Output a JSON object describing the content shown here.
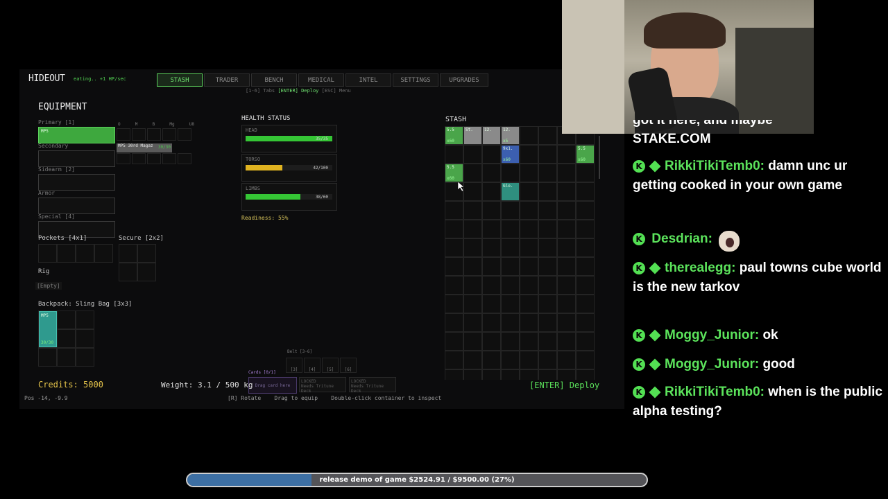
{
  "hud": {
    "title": "HIDEOUT",
    "regen": "eating.. +1 HP/sec",
    "tabs": [
      "STASH",
      "TRADER",
      "BENCH",
      "MEDICAL",
      "INTEL",
      "SETTINGS",
      "UPGRADES"
    ],
    "active_tab": "STASH",
    "hint_keys": "[1-6] Tabs",
    "hint_deploy": "[ENTER] Deploy",
    "hint_menu": "[ESC] Menu"
  },
  "equipment": {
    "heading": "EQUIPMENT",
    "primary_label": "Primary [1]",
    "primary_item": "MP5",
    "attach_labels": [
      "O",
      "M",
      "B",
      "Mg",
      "U8"
    ],
    "secondary_label": "Secondary",
    "mag_label": "MP5 30rd Magaz",
    "mag_count": "30/30",
    "sidearm_label": "Sidearm [2]",
    "armor_label": "Armor",
    "special_label": "Special [4]",
    "pockets_label": "Pockets [4x1]",
    "secure_label": "Secure [2x2]",
    "rig_label": "Rig",
    "rig_empty": "[Empty]",
    "backpack_label": "Backpack: Sling Bag [3x3]",
    "backpack_item": "MP5",
    "backpack_count": "30/30"
  },
  "health": {
    "heading": "HEALTH STATUS",
    "parts": [
      {
        "name": "HEAD",
        "value": "35/35",
        "fraction": 1.0,
        "color": "#35c635"
      },
      {
        "name": "TORSO",
        "value": "42/100",
        "fraction": 0.42,
        "color": "#e0b320"
      },
      {
        "name": "LIMBS",
        "value": "38/60",
        "fraction": 0.63,
        "color": "#35c635"
      }
    ],
    "readiness": "Readiness: 55%"
  },
  "stash": {
    "heading": "STASH",
    "items": [
      {
        "label": "5.5",
        "count": "x60",
        "color": "#4aa54a",
        "col": 0,
        "row": 0
      },
      {
        "label": "St.",
        "count": "",
        "color": "#8a8a8a",
        "col": 1,
        "row": 0
      },
      {
        "label": "12.",
        "count": "",
        "color": "#8a8a8a",
        "col": 2,
        "row": 0
      },
      {
        "label": "12.",
        "count": "x5",
        "color": "#8a8a8a",
        "col": 3,
        "row": 0
      },
      {
        "label": "9x1.",
        "count": "x60",
        "color": "#3c5fb0",
        "col": 3,
        "row": 1
      },
      {
        "label": "5.5",
        "count": "x60",
        "color": "#4aa54a",
        "col": 7,
        "row": 1
      },
      {
        "label": "5.5",
        "count": "x60",
        "color": "#4aa54a",
        "col": 0,
        "row": 2
      },
      {
        "label": "Glo.",
        "count": "",
        "color": "#2f8f7f",
        "col": 3,
        "row": 3
      }
    ]
  },
  "bottom": {
    "belt_label": "Belt [3-6]",
    "belt_slots": [
      "[3]",
      "[4]",
      "[5]",
      "[6]"
    ],
    "cards_label": "Cards [0/1]",
    "card_slot": "Drag card here",
    "locked_1": "LOCKED",
    "locked_1_sub": "Needs Tritune Deck",
    "locked_2": "LOCKED",
    "locked_2_sub": "Needs Tritune Deck",
    "credits": "Credits: 5000",
    "weight": "Weight: 3.1 / 500 kg",
    "pos": "Pos -14, -9.9",
    "controls": "[R] Rotate    Drag to equip    Double-click container to inspect",
    "deploy": "[ENTER] Deploy"
  },
  "chat": {
    "partial_top": "got it here, and maybe",
    "partial_second": "STAKE.COM",
    "messages": [
      {
        "user": "RikkiTikiTemb0:",
        "text": "damn unc ur getting cooked in your own game"
      },
      {
        "user": "Desdrian:",
        "text": ""
      },
      {
        "user": "therealegg:",
        "text": "paul towns cube world is the new tarkov"
      },
      {
        "user": "Moggy_Junior:",
        "text": "ok"
      },
      {
        "user": "Moggy_Junior:",
        "text": "good"
      },
      {
        "user": "RikkiTikiTemb0:",
        "text": "when is the public alpha testing?"
      }
    ]
  },
  "goal": {
    "text": "release demo of game $2524.91 / $9500.00 (27%)",
    "fraction": 0.27
  }
}
